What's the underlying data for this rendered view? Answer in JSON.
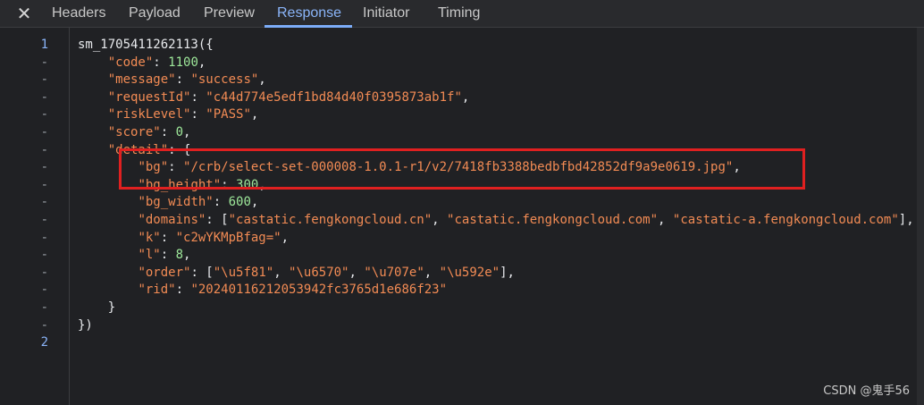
{
  "tabs": {
    "close_icon": "✕",
    "items": [
      "Headers",
      "Payload",
      "Preview",
      "Response",
      "Initiator",
      "Timing"
    ],
    "active": "Response"
  },
  "gutter": [
    "1",
    "-",
    "-",
    "-",
    "-",
    "-",
    "-",
    "-",
    "-",
    "-",
    "-",
    "-",
    "-",
    "-",
    "-",
    "-",
    "-",
    "2"
  ],
  "code_lines": [
    "sm_1705411262113({",
    "    \"code\": 1100,",
    "    \"message\": \"success\",",
    "    \"requestId\": \"c44d774e5edf1bd84d40f0395873ab1f\",",
    "    \"riskLevel\": \"PASS\",",
    "    \"score\": 0,",
    "    \"detail\": {",
    "        \"bg\": \"/crb/select-set-000008-1.0.1-r1/v2/7418fb3388bedbfbd42852df9a9e0619.jpg\",",
    "        \"bg_height\": 300,",
    "        \"bg_width\": 600,",
    "        \"domains\": [\"castatic.fengkongcloud.cn\", \"castatic.fengkongcloud.com\", \"castatic-a.fengkongcloud.com\"],",
    "        \"k\": \"c2wYKMpBfag=\",",
    "        \"l\": 8,",
    "        \"order\": [\"\\u5f81\", \"\\u6570\", \"\\u707e\", \"\\u592e\"],",
    "        \"rid\": \"20240116212053942fc3765d1e686f23\"",
    "    }",
    "})",
    ""
  ],
  "watermark": "CSDN @鬼手56",
  "colors": {
    "background": "#202124",
    "key": "#f28b54",
    "number": "#9ee89a",
    "active_tab": "#8ab4f8",
    "highlight": "#e02020"
  }
}
